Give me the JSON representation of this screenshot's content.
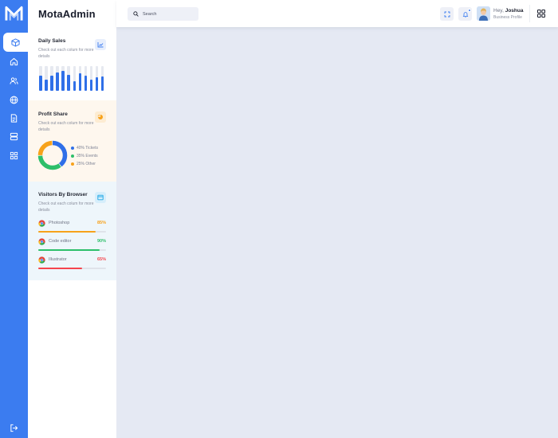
{
  "app": {
    "brand": "MotaAdmin"
  },
  "colors": {
    "accent": "#3b7cf0",
    "orange": "#f7a21b",
    "green": "#2dbf6a",
    "red": "#f5454d"
  },
  "rail": {
    "items": [
      {
        "icon": "cube-icon",
        "active": true
      },
      {
        "icon": "home-icon",
        "active": false
      },
      {
        "icon": "users-icon",
        "active": false
      },
      {
        "icon": "globe-icon",
        "active": false
      },
      {
        "icon": "document-icon",
        "active": false
      },
      {
        "icon": "layers-icon",
        "active": false
      },
      {
        "icon": "apps-icon",
        "active": false
      }
    ],
    "logout_icon": "logout-icon"
  },
  "header": {
    "search_placeholder": "Search",
    "greeting": "Hey,",
    "user_name": "Joshua",
    "user_role": "Business Profile"
  },
  "daily_sales": {
    "title": "Daily Sales",
    "subtitle": "Check out each colum for more details",
    "bar_fractions": [
      0.6,
      0.45,
      0.6,
      0.75,
      0.8,
      0.65,
      0.38,
      0.72,
      0.6,
      0.45,
      0.55,
      0.58
    ]
  },
  "profit_share": {
    "title": "Profit Share",
    "subtitle": "Check out each colum for more details",
    "legend": [
      {
        "label": "40% Tickets",
        "color": "#2f6fe8",
        "value": 40
      },
      {
        "label": "35% Events",
        "color": "#2dbf6a",
        "value": 35
      },
      {
        "label": "25% Other",
        "color": "#f7a21b",
        "value": 25
      }
    ]
  },
  "visitors": {
    "title": "Visitors By Browser",
    "subtitle": "Check out each colum for more details",
    "rows": [
      {
        "label": "Photoshop",
        "pct": "85%",
        "value": 0.85,
        "color": "#f7a21b"
      },
      {
        "label": "Code editor",
        "pct": "90%",
        "value": 0.9,
        "color": "#2dbf6a"
      },
      {
        "label": "Illustrator",
        "pct": "65%",
        "value": 0.65,
        "color": "#f5454d"
      }
    ]
  }
}
